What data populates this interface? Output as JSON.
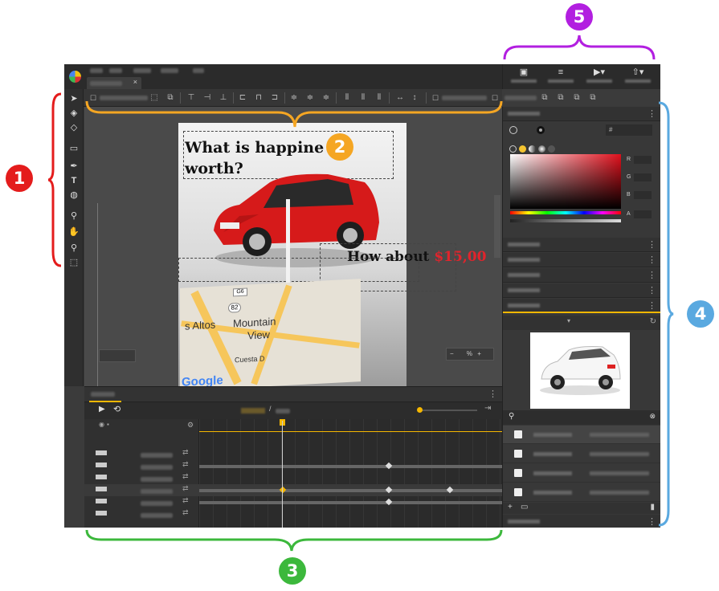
{
  "canvas": {
    "headline": "What is happine",
    "headline_line2": "worth?",
    "offer_prefix": "How about",
    "offer_price": "$15,00",
    "map_label_1": "s Altos",
    "map_label_2": "Mountain",
    "map_label_3": "View",
    "map_label_4": "Cuesta D",
    "map_brand": "Google",
    "route_a": "82",
    "route_b": "G6"
  },
  "doc_tab": {
    "close_glyph": "×"
  },
  "zoom_control": {
    "minus": "−",
    "percent": "%",
    "plus": "+"
  },
  "timeline": {
    "time_sep": "/"
  },
  "color_panel": {
    "hex_prefix": "#",
    "labels": [
      "R",
      "G",
      "B",
      "A"
    ]
  },
  "annotations": [
    {
      "label": "1",
      "color": "#e41c1c"
    },
    {
      "label": "2",
      "color": "#f5a623"
    },
    {
      "label": "3",
      "color": "#3cb83c"
    },
    {
      "label": "4",
      "color": "#5aa9e0"
    },
    {
      "label": "5",
      "color": "#b21fe0"
    }
  ],
  "icons": {
    "tools": [
      "select-arrow-icon",
      "3d-rotate-icon",
      "3d-translate-icon",
      "tag-icon",
      "pen-icon",
      "text-icon",
      "paint-bucket-icon",
      "stamp-icon",
      "hand-icon",
      "zoom-icon",
      "crop-icon"
    ],
    "right_header": [
      "image-icon",
      "text-align-icon",
      "play-icon",
      "publish-icon"
    ]
  }
}
